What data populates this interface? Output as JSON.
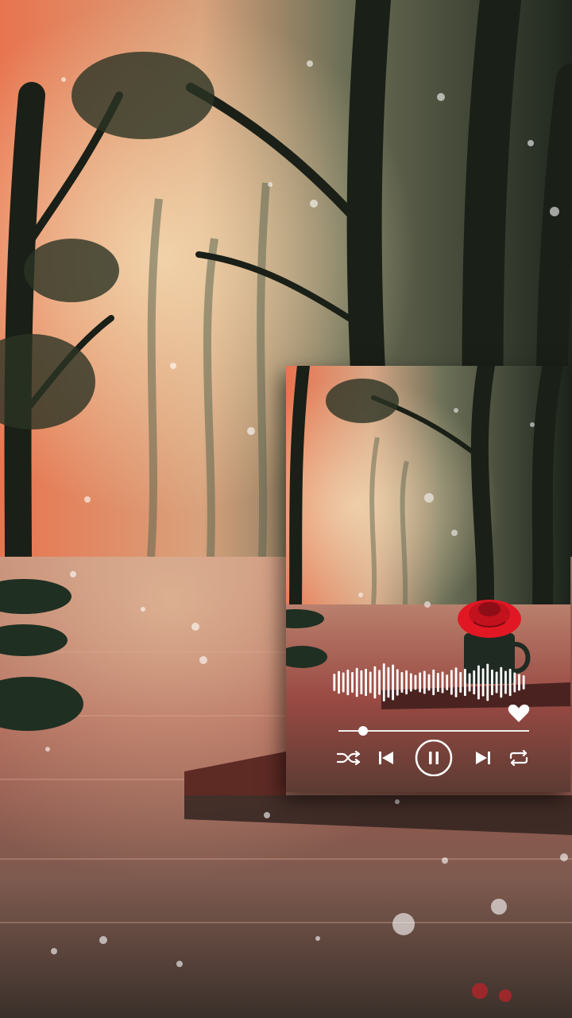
{
  "player": {
    "progress_fraction": 0.13,
    "state": "playing",
    "liked": true,
    "waveform_levels": [
      0.42,
      0.55,
      0.48,
      0.62,
      0.5,
      0.7,
      0.58,
      0.66,
      0.52,
      0.78,
      0.6,
      0.92,
      0.74,
      0.86,
      0.64,
      0.5,
      0.58,
      0.44,
      0.36,
      0.48,
      0.56,
      0.4,
      0.62,
      0.46,
      0.52,
      0.38,
      0.6,
      0.72,
      0.5,
      0.66,
      0.44,
      0.58,
      0.82,
      0.68,
      0.9,
      0.62,
      0.52,
      0.74,
      0.56,
      0.66,
      0.48,
      0.4,
      0.34
    ],
    "controls": [
      {
        "name": "shuffle-button",
        "icon": "shuffle-icon"
      },
      {
        "name": "previous-button",
        "icon": "skip-previous-icon"
      },
      {
        "name": "play-pause-button",
        "icon": "pause-icon"
      },
      {
        "name": "next-button",
        "icon": "skip-next-icon"
      },
      {
        "name": "repeat-button",
        "icon": "repeat-icon"
      }
    ],
    "colors": {
      "icon": "#ffffff",
      "heart": "#ffffff",
      "rose": "#e11824",
      "accent_sky": "#f08a5a"
    }
  }
}
